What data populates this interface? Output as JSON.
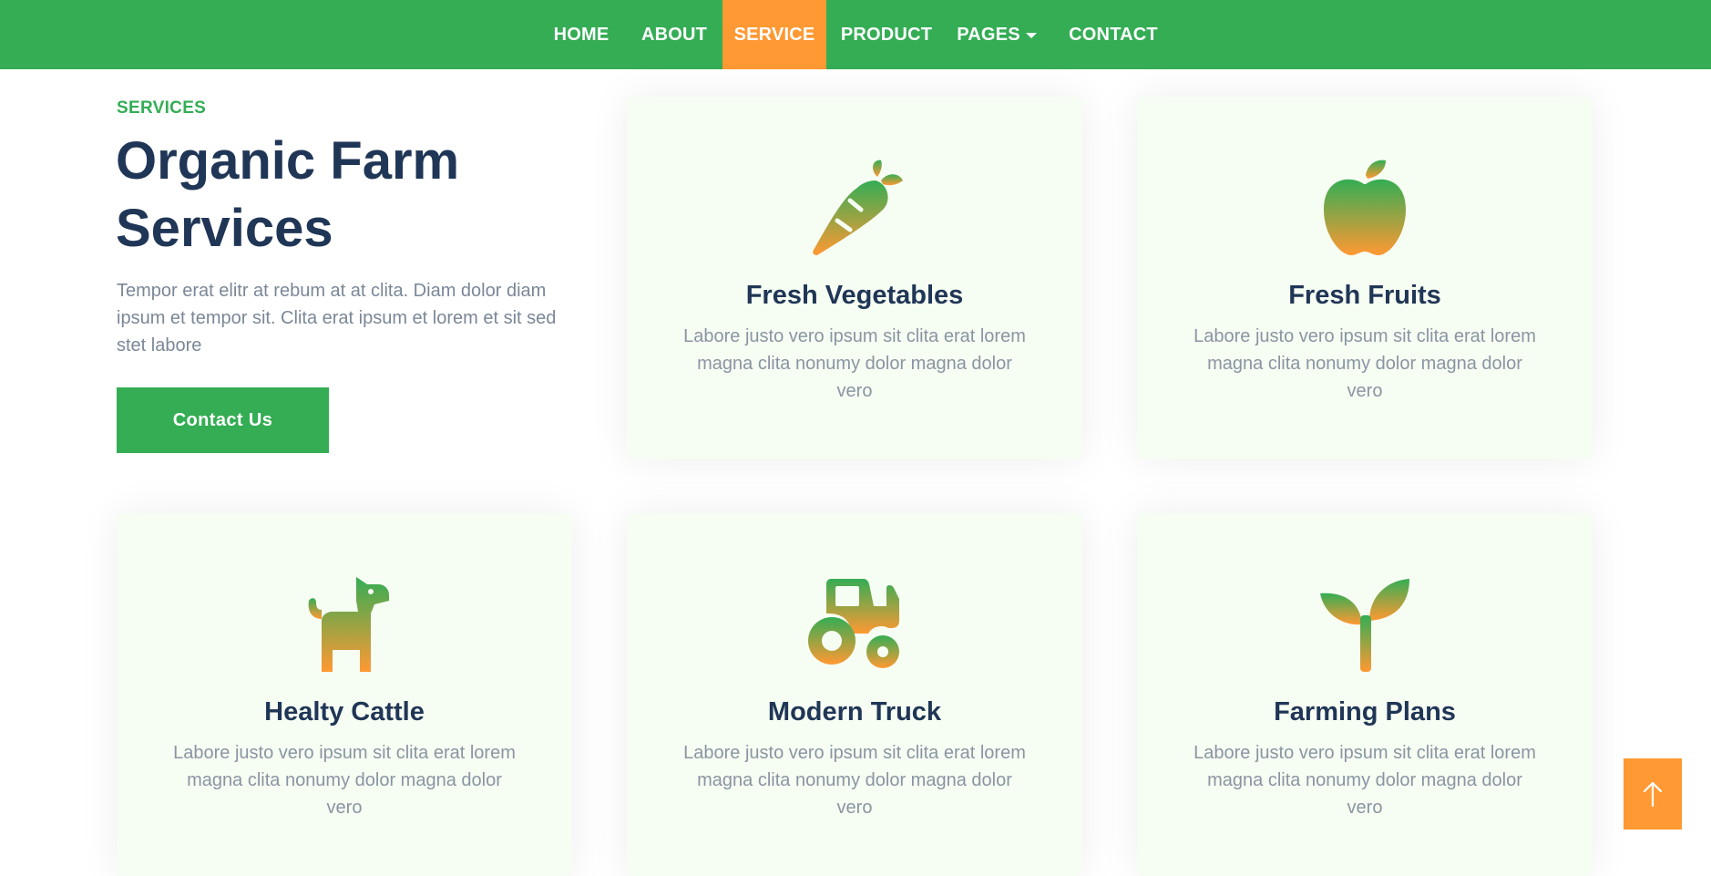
{
  "nav": {
    "items": [
      {
        "label": "HOME"
      },
      {
        "label": "ABOUT"
      },
      {
        "label": "SERVICE"
      },
      {
        "label": "PRODUCT"
      },
      {
        "label": "PAGES"
      },
      {
        "label": "CONTACT"
      }
    ],
    "active": "SERVICE"
  },
  "hero": {
    "eyebrow": "SERVICES",
    "title_line1": "Organic Farm",
    "title_line2": "Services",
    "description": "Tempor erat elitr at rebum at at clita. Diam dolor diam ipsum et tempor sit. Clita erat ipsum et lorem et sit sed stet labore",
    "cta_label": "Contact Us"
  },
  "services": [
    {
      "title": "Fresh Vegetables",
      "text": "Labore justo vero ipsum sit clita erat lorem magna clita nonumy dolor magna dolor vero",
      "icon": "carrot-icon"
    },
    {
      "title": "Fresh Fruits",
      "text": "Labore justo vero ipsum sit clita erat lorem magna clita nonumy dolor magna dolor vero",
      "icon": "apple-icon"
    },
    {
      "title": "Healty Cattle",
      "text": "Labore justo vero ipsum sit clita erat lorem magna clita nonumy dolor magna dolor vero",
      "icon": "dog-icon"
    },
    {
      "title": "Modern Truck",
      "text": "Labore justo vero ipsum sit clita erat lorem magna clita nonumy dolor magna dolor vero",
      "icon": "tractor-icon"
    },
    {
      "title": "Farming Plans",
      "text": "Labore justo vero ipsum sit clita erat lorem magna clita nonumy dolor magna dolor vero",
      "icon": "seedling-icon"
    }
  ],
  "colors": {
    "primary_green": "#34AD54",
    "accent_orange": "#FF9933",
    "heading_navy": "#203656",
    "card_background": "#F6FDF2"
  },
  "back_to_top_icon": "arrow-up-icon"
}
